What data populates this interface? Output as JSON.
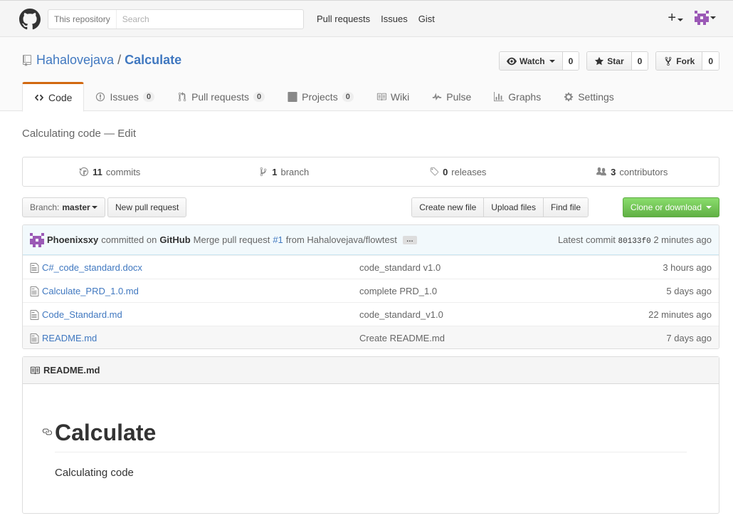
{
  "header": {
    "search_scope": "This repository",
    "search_placeholder": "Search",
    "nav": [
      "Pull requests",
      "Issues",
      "Gist"
    ],
    "plus_symbol": "+"
  },
  "repo": {
    "owner": "Hahalovejava",
    "separator": "/",
    "name": "Calculate",
    "watch_label": "Watch",
    "watch_count": "0",
    "star_label": "Star",
    "star_count": "0",
    "fork_label": "Fork",
    "fork_count": "0"
  },
  "tabs": [
    {
      "label": "Code",
      "icon": "code-icon"
    },
    {
      "label": "Issues",
      "count": "0",
      "icon": "issue-icon"
    },
    {
      "label": "Pull requests",
      "count": "0",
      "icon": "pull-request-icon"
    },
    {
      "label": "Projects",
      "count": "0",
      "icon": "project-icon"
    },
    {
      "label": "Wiki",
      "icon": "book-icon"
    },
    {
      "label": "Pulse",
      "icon": "pulse-icon"
    },
    {
      "label": "Graphs",
      "icon": "graph-icon"
    },
    {
      "label": "Settings",
      "icon": "gear-icon"
    }
  ],
  "description": {
    "text": "Calculating code",
    "dash": "—",
    "edit": "Edit"
  },
  "summary": {
    "commits_count": "11",
    "commits_label": "commits",
    "branch_count": "1",
    "branch_label": "branch",
    "releases_count": "0",
    "releases_label": "releases",
    "contributors_count": "3",
    "contributors_label": "contributors"
  },
  "filenav": {
    "branch_label": "Branch:",
    "branch_value": "master",
    "new_pr": "New pull request",
    "create_file": "Create new file",
    "upload_files": "Upload files",
    "find_file": "Find file",
    "clone": "Clone or download"
  },
  "commit": {
    "author": "Phoenixsxy",
    "committed": "committed on",
    "platform": "GitHub",
    "message_prefix": "Merge pull request",
    "pr_ref": "#1",
    "message_suffix": "from Hahalovejava/flowtest",
    "ellipsis": "…",
    "latest_label": "Latest commit",
    "sha": "80133f0",
    "age": "2 minutes ago"
  },
  "files": [
    {
      "name": "C#_code_standard.docx",
      "message": "code_standard v1.0",
      "age": "3 hours ago"
    },
    {
      "name": "Calculate_PRD_1.0.md",
      "message": "complete PRD_1.0",
      "age": "5 days ago"
    },
    {
      "name": "Code_Standard.md",
      "message": "code_standard_v1.0",
      "age": "22 minutes ago"
    },
    {
      "name": "README.md",
      "message": "Create README.md",
      "age": "7 days ago"
    }
  ],
  "readme": {
    "filename": "README.md",
    "heading": "Calculate",
    "body": "Calculating code"
  },
  "colors": {
    "link": "#4078c0",
    "tab_accent": "#d26911",
    "clone_green": "#60b044",
    "avatar_purple": "#9b59b6"
  }
}
